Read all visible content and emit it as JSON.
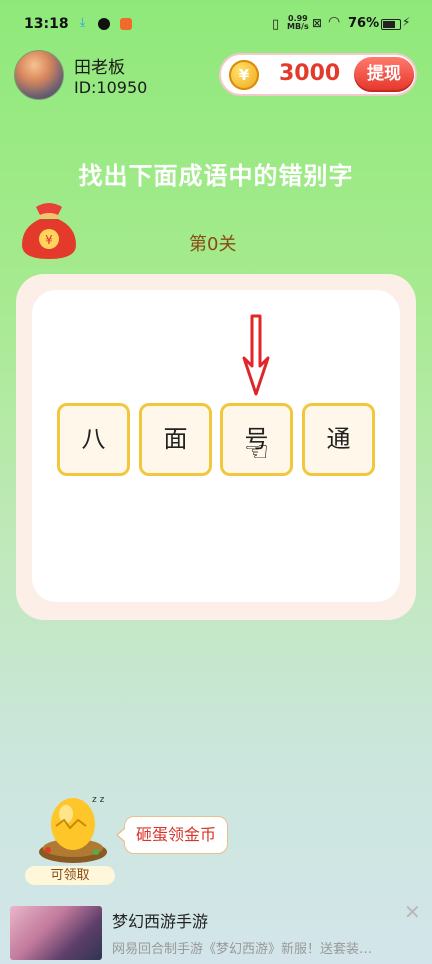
{
  "status_bar": {
    "time": "13:18",
    "net_speed_value": "0.99",
    "net_speed_unit": "MB/s",
    "battery": "76%"
  },
  "user": {
    "name": "田老板",
    "id": "ID:10950"
  },
  "wallet": {
    "coins": "3000",
    "withdraw_label": "提现"
  },
  "game": {
    "title": "找出下面成语中的错别字",
    "level": "第0关",
    "tiles": [
      "八",
      "面",
      "号",
      "通"
    ]
  },
  "rewards": {
    "egg_label": "可领取",
    "egg_bubble": "砸蛋领金币"
  },
  "ad": {
    "title": "梦幻西游手游",
    "description": "网易回合制手游《梦幻西游》新服！送套装…"
  },
  "colors": {
    "accent_red": "#e33a2c",
    "tile_border": "#f1c73e",
    "level_text": "#8a4a14"
  },
  "icons": [
    "download-icon",
    "vibrate-icon",
    "wifi-icon",
    "battery-icon",
    "coin-icon",
    "red-pack-icon",
    "arrow-down-icon",
    "hand-pointer-icon",
    "golden-egg-icon",
    "close-icon"
  ]
}
